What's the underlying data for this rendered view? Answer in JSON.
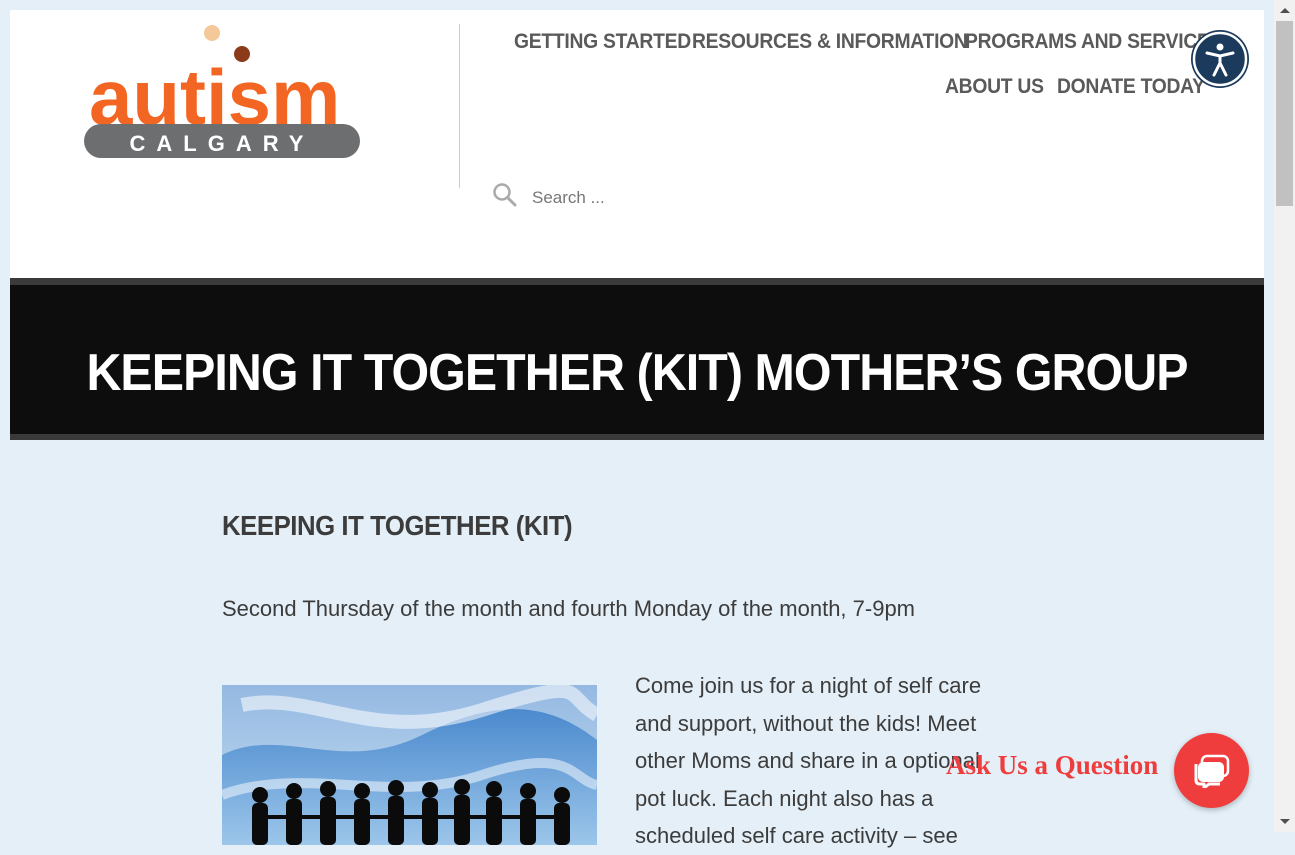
{
  "logo": {
    "word": "autism",
    "city": "CALGARY"
  },
  "nav": {
    "items": [
      "GETTING STARTED",
      "RESOURCES & INFORMATION",
      "PROGRAMS AND SERVICES",
      "ABOUT US",
      "DONATE TODAY"
    ]
  },
  "search": {
    "placeholder": "Search ..."
  },
  "hero": {
    "title": "KEEPING IT TOGETHER (KIT) MOTHER’S GROUP"
  },
  "content": {
    "heading": "KEEPING IT TOGETHER (KIT)",
    "schedule": "Second Thursday of the month and fourth Monday of the month,  7-9pm",
    "intro_lines": [
      "Come join us for a night of self care",
      "and support, without the kids! Meet",
      "other Moms and share in a optional",
      "pot luck. Each night also has a",
      "scheduled self care activity – see"
    ]
  },
  "chat": {
    "label": "Ask Us a Question"
  },
  "colors": {
    "page_bg": "#e4eff7",
    "logo_orange": "#f26522",
    "logo_grey": "#6d6e70",
    "hero_bg": "#0d0d0d",
    "chat_red": "#ef3d3d",
    "a11y_navy": "#1b3a5c",
    "nav_text": "#5a5a5a"
  },
  "icons": [
    "accessibility-icon",
    "search-icon",
    "chat-bubble-icon"
  ]
}
